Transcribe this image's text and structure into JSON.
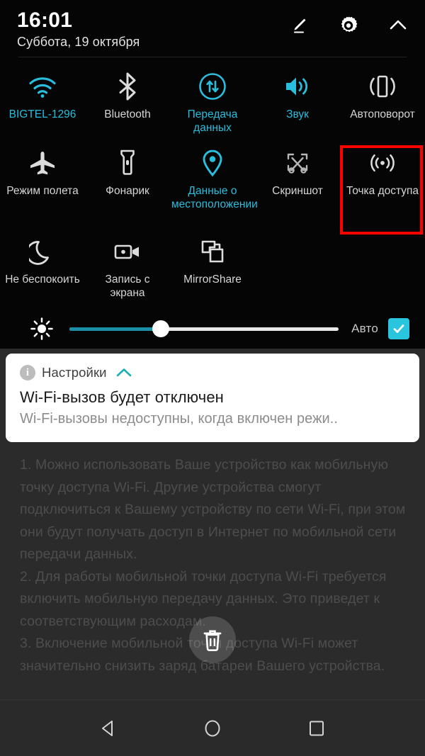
{
  "status_bar": {
    "time": "16:01",
    "date": "Суббота, 19 октября"
  },
  "header_actions": [
    {
      "name": "edit-icon",
      "label": "Редактировать"
    },
    {
      "name": "settings-gear-icon",
      "label": "Настройки"
    },
    {
      "name": "collapse-chevron-up-icon",
      "label": "Свернуть"
    }
  ],
  "quick_settings": {
    "rows": [
      [
        {
          "label": "BIGTEL-1296",
          "icon": "wifi-icon",
          "active": true
        },
        {
          "label": "Bluetooth",
          "icon": "bluetooth-icon",
          "active": false
        },
        {
          "label": "Передача данных",
          "icon": "mobile-data-icon",
          "active": true
        },
        {
          "label": "Звук",
          "icon": "sound-icon",
          "active": true
        },
        {
          "label": "Автоповорот",
          "icon": "auto-rotate-icon",
          "active": false
        }
      ],
      [
        {
          "label": "Режим полета",
          "icon": "airplane-icon",
          "active": false
        },
        {
          "label": "Фонарик",
          "icon": "flashlight-icon",
          "active": false
        },
        {
          "label": "Данные о местоположении",
          "icon": "location-pin-icon",
          "active": true
        },
        {
          "label": "Скриншот",
          "icon": "screenshot-scissors-icon",
          "active": false
        },
        {
          "label": "Точка доступа",
          "icon": "hotspot-icon",
          "active": false,
          "highlighted": true
        }
      ],
      [
        {
          "label": "Не беспокоить",
          "icon": "moon-icon",
          "active": false
        },
        {
          "label": "Запись с экрана",
          "icon": "screen-record-icon",
          "active": false
        },
        {
          "label": "MirrorShare",
          "icon": "mirror-share-icon",
          "active": false
        }
      ]
    ],
    "highlight_color": "#fe0000",
    "active_color": "#29bedd"
  },
  "brightness": {
    "icon": "brightness-bulb-icon",
    "value_percent": 34,
    "auto_label": "Авто",
    "auto_checked": true,
    "fill_color": "#1b8fa8",
    "checkbox_color": "#29c4dd"
  },
  "notification": {
    "app_name": "Настройки",
    "app_icon": "info-circle-icon",
    "expand_icon": "chevron-up-icon",
    "title": "Wi-Fi-вызов будет отключен",
    "body": "Wi-Fi-вызовы недоступны, когда включен режи..",
    "accent_color": "#19b0b8"
  },
  "background_content": {
    "paragraphs": [
      "1. Можно использовать Ваше устройство как мобильную точку доступа Wi-Fi. Другие устройства смогут подключиться к Вашему устройству по сети Wi-Fi, при этом они будут получать доступ в Интернет по мобильной сети передачи данных.",
      "2. Для работы мобильной точки доступа Wi-Fi требуется включить мобильную передачу данных. Это приведет к соответствующим расходам.",
      "3. Включение мобильной точки доступа Wi-Fi может значительно снизить заряд батареи Вашего устройства."
    ],
    "floating_button": {
      "icon": "trash-icon",
      "label": "Удалить"
    }
  },
  "nav_bar": [
    {
      "name": "back-button",
      "icon": "triangle-back-icon"
    },
    {
      "name": "home-button",
      "icon": "circle-home-icon"
    },
    {
      "name": "recents-button",
      "icon": "square-recents-icon"
    }
  ]
}
